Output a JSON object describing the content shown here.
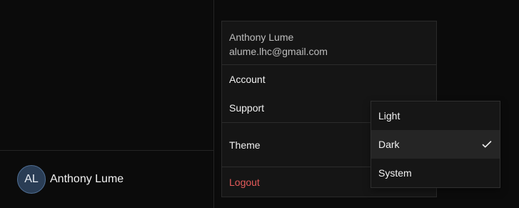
{
  "sidebar": {
    "profile": {
      "avatar_initials": "AL",
      "name": "Anthony Lume"
    }
  },
  "menu": {
    "user": {
      "name": "Anthony Lume",
      "email": "alume.lhc@gmail.com"
    },
    "items": {
      "account": "Account",
      "support": "Support",
      "theme": "Theme",
      "logout": "Logout"
    }
  },
  "theme_options": [
    {
      "label": "Light",
      "selected": false
    },
    {
      "label": "Dark",
      "selected": true
    },
    {
      "label": "System",
      "selected": false
    }
  ],
  "icons": {
    "theme_trigger": "moon-icon",
    "selected_option": "check-icon"
  },
  "colors": {
    "background": "#0b0b0b",
    "panel": "#151515",
    "dropdown": "#161616",
    "selected_option": "#252525",
    "border": "#2a2a2a",
    "text_primary": "#f0f0f0",
    "text_secondary": "#bdbdbd",
    "logout": "#e55a5a",
    "avatar_bg": "#2a3d55",
    "avatar_border": "#4f6e93"
  }
}
